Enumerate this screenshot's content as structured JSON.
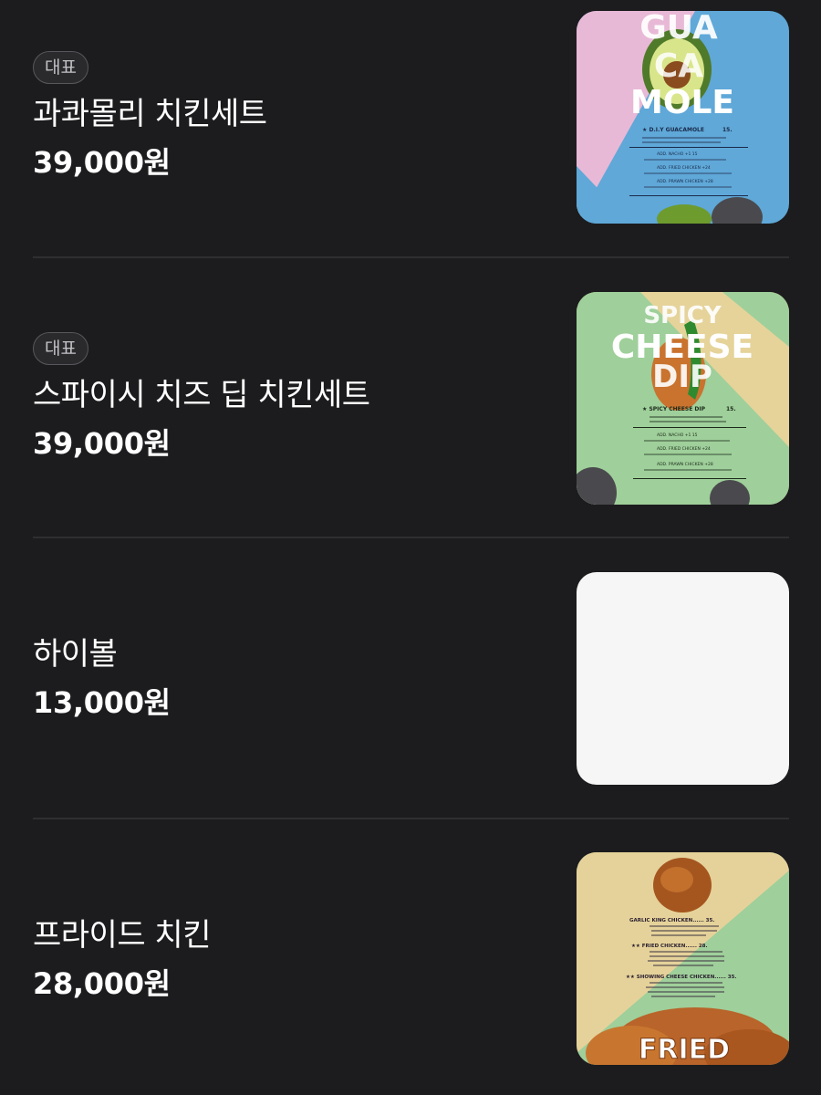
{
  "items": [
    {
      "badge": "대표",
      "name": "과콰몰리 치킨세트",
      "price": "39,000원",
      "image": {
        "title_lines": [
          "GUA",
          "CA",
          "MOLE"
        ],
        "headline": "★ D.I.Y GUACAMOLE",
        "headline_price": "15.",
        "add_lines": [
          "ADD. NACHO +1 15",
          "ADD. FRIED CHICKEN +24",
          "ADD. PRAWN CHICKEN +28"
        ],
        "colors": {
          "left": "#e8b9d6",
          "right": "#5fa8d8"
        }
      }
    },
    {
      "badge": "대표",
      "name": "스파이시 치즈 딥 치킨세트",
      "price": "39,000원",
      "image": {
        "title_lines": [
          "SPICY",
          "CHEESE",
          "DIP"
        ],
        "headline": "★ SPICY CHEESE DIP",
        "headline_price": "15.",
        "add_lines": [
          "ADD. NACHO +1 15",
          "ADD. FRIED CHICKEN +24",
          "ADD. PRAWN CHICKEN +28"
        ],
        "colors": {
          "left": "#9fcf9a",
          "right": "#e5d39a"
        }
      }
    },
    {
      "badge": "",
      "name": "하이볼",
      "price": "13,000원",
      "image": null
    },
    {
      "badge": "",
      "name": "프라이드 치킨",
      "price": "28,000원",
      "image": {
        "title_lines": [
          "FRIED"
        ],
        "menu_lines": [
          "GARLIC KING CHICKEN...... 35.",
          "★★ FRIED CHICKEN...... 28.",
          "★★ SHOWING CHEESE CHICKEN...... 35."
        ],
        "colors": {
          "left": "#e5d29a",
          "right": "#9fcf9a"
        }
      }
    }
  ]
}
